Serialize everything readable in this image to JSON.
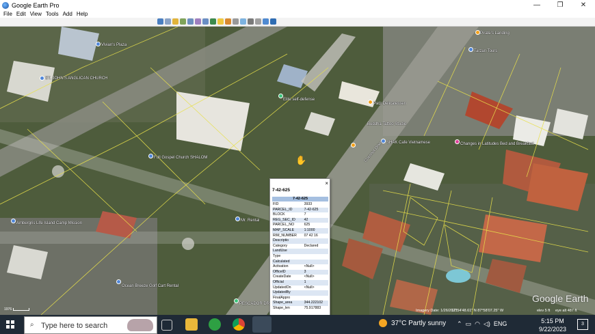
{
  "window": {
    "title": "Google Earth Pro",
    "minimize": "—",
    "maximize": "❐",
    "close": "✕"
  },
  "menu": [
    "File",
    "Edit",
    "View",
    "Tools",
    "Add",
    "Help"
  ],
  "map": {
    "places": [
      {
        "label": "Pirate's Landing",
        "icon": "place-pin"
      },
      {
        "label": "Tarzan Tours",
        "icon": "place-pin"
      },
      {
        "label": "ST. JOHN'S ANGLICAN CHURCH",
        "icon": "church-pin"
      },
      {
        "label": "Elite self-defense",
        "icon": "place-pin"
      },
      {
        "label": "Patz Delicatessen",
        "icon": "food-pin"
      },
      {
        "label": "Buddha Tattoo Studio",
        "icon": "place-pin"
      },
      {
        "label": "SHAK Cafe Vietnamese",
        "icon": "place-pin"
      },
      {
        "label": "Changes in Latitudes Bed and Breakfast",
        "icon": "hotel-pin"
      },
      {
        "label": "Full Gospel Church SHALOM",
        "icon": "church-pin"
      },
      {
        "label": "Mr. Rental",
        "icon": "place-pin"
      },
      {
        "label": "Ambergris Life Island Camp Mission",
        "icon": "place-pin"
      },
      {
        "label": "Ocean Breeze Golf Cart Rental",
        "icon": "place-pin"
      },
      {
        "label": "Coconut Drive",
        "icon": "road-label"
      },
      {
        "label": "Vivian's Plaza",
        "icon": "place-pin"
      },
      {
        "label": "PESCADOR DRIVE",
        "icon": "road-label"
      }
    ],
    "scale": "1976",
    "imagery_date": "Imagery Date: 1/26/2021",
    "coords": "17°54'48.61\" N   87°58'07.25\" W",
    "elev": "elev  5 ft",
    "eye_alt": "eye alt  487 ft",
    "logo": "Google Earth"
  },
  "balloon": {
    "title": "7-42-625",
    "close": "×",
    "table_header": "7-42-625",
    "rows": [
      {
        "k": "FID",
        "v": "3933"
      },
      {
        "k": "PARCEL_ID",
        "v": "7-42-625"
      },
      {
        "k": "BLOCK",
        "v": "7"
      },
      {
        "k": "REG_SEC_ID",
        "v": "42"
      },
      {
        "k": "PARCEL_NO",
        "v": "625"
      },
      {
        "k": "MAP_SCALE",
        "v": "1:1000"
      },
      {
        "k": "RIM_NUMBER",
        "v": "07 42 16"
      },
      {
        "k": "Descriptio",
        "v": ""
      },
      {
        "k": "Category",
        "v": "Declared"
      },
      {
        "k": "LandUse",
        "v": ""
      },
      {
        "k": "Type",
        "v": ""
      },
      {
        "k": "Calculated",
        "v": ""
      },
      {
        "k": "Activation",
        "v": "<Null>"
      },
      {
        "k": "OfficeID",
        "v": "3"
      },
      {
        "k": "CreateDate",
        "v": "<Null>"
      },
      {
        "k": "Official",
        "v": "1"
      },
      {
        "k": "UpdatedOn",
        "v": "<Null>"
      },
      {
        "k": "UpdatedBy",
        "v": ""
      },
      {
        "k": "FinalAppro",
        "v": ""
      },
      {
        "k": "Shape_area",
        "v": "344.222102"
      },
      {
        "k": "Shape_len",
        "v": "75.917883"
      }
    ]
  },
  "taskbar": {
    "search_placeholder": "Type here to search",
    "weather": "37°C  Partly sunny",
    "lang": "ENG",
    "time": "5:15 PM",
    "date": "9/22/2023",
    "notif_count": "3"
  }
}
